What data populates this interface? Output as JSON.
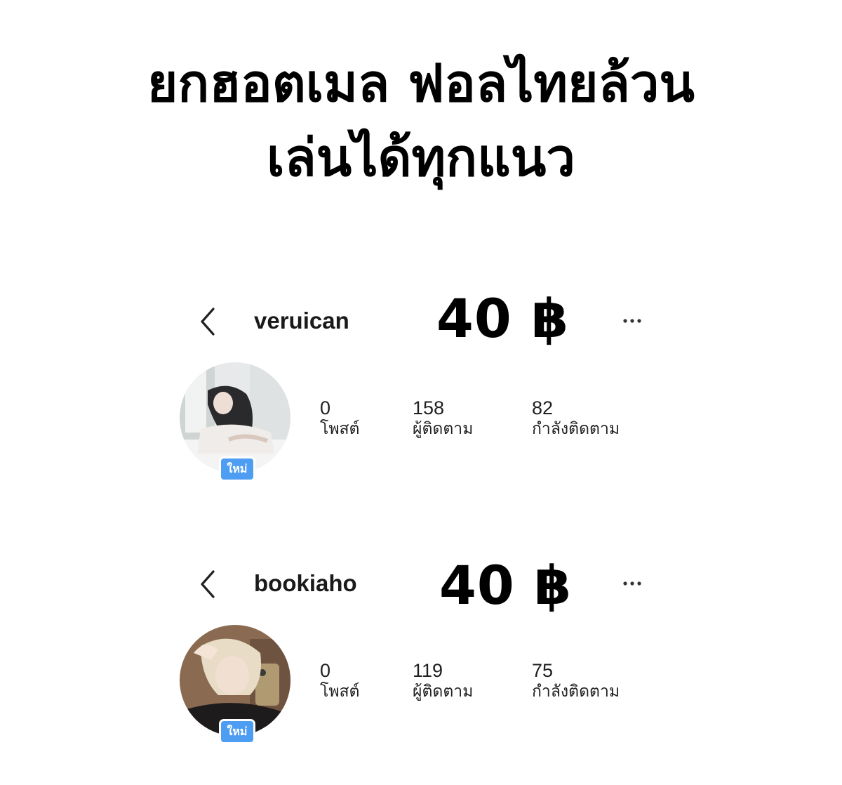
{
  "headline": {
    "line1": "ยกฮอตเมล ฟอลไทยล้วน",
    "line2": "เล่นได้ทุกแนว"
  },
  "accounts": [
    {
      "username": "veruican",
      "price": "40 ฿",
      "badge": "ใหม่",
      "stats": {
        "posts_value": "0",
        "posts_label": "โพสต์",
        "followers_value": "158",
        "followers_label": "ผู้ติดตาม",
        "following_value": "82",
        "following_label": "กำลังติดตาม"
      }
    },
    {
      "username": "bookiaho",
      "price": "40 ฿",
      "badge": "ใหม่",
      "stats": {
        "posts_value": "0",
        "posts_label": "โพสต์",
        "followers_value": "119",
        "followers_label": "ผู้ติดตาม",
        "following_value": "75",
        "following_label": "กำลังติดตาม"
      }
    }
  ],
  "icons": {
    "back": "chevron-left-icon",
    "more": "more-horizontal-icon"
  },
  "colors": {
    "badge": "#4d9df2",
    "text": "#111111",
    "background": "#ffffff"
  }
}
